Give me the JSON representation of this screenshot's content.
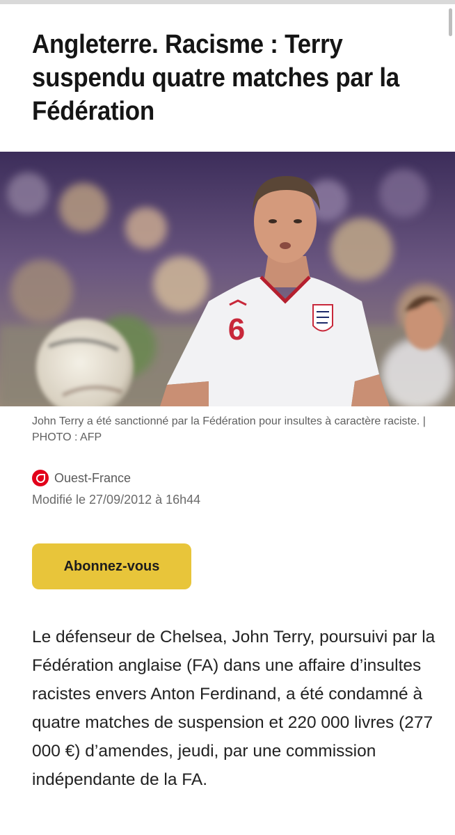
{
  "article": {
    "headline": "Angleterre. Racisme : Terry suspendu quatre matches par la Fédération",
    "image_caption": "John Terry a été sanctionné par la Fédération pour insultes à caractère raciste. | PHOTO : AFP",
    "jersey_number": "6",
    "source_name": "Ouest-France",
    "source_logo_icon": "ouest-france-logo-icon",
    "modified": "Modifié le 27/09/2012 à 16h44",
    "subscribe_label": "Abonnez-vous",
    "body": "Le défenseur de Chelsea, John Terry, poursuivi par la Fédération anglaise (FA) dans une affaire d’insultes racistes envers Anton Ferdinand, a été condamné à quatre matches de suspension et 220 000 livres (277 000 €) d’amendes, jeudi, par une commission indépendante de la FA."
  },
  "colors": {
    "subscribe_button": "#e8c53a",
    "brand_red": "#e2001a",
    "caption_text": "#5f5f5f"
  }
}
